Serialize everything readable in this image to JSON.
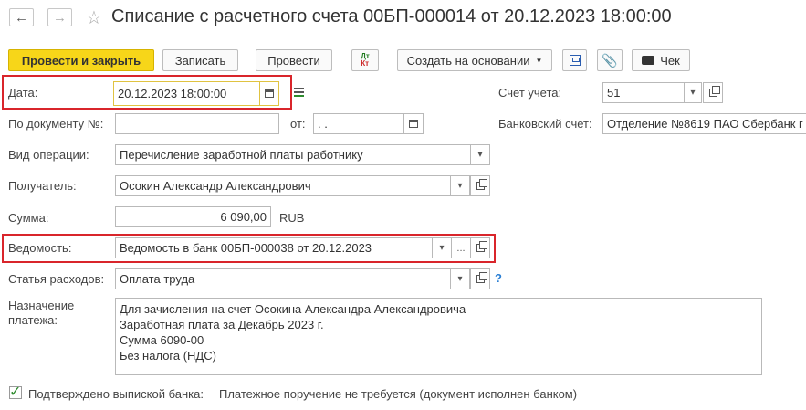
{
  "window": {
    "title": "Списание с расчетного счета 00БП-000014 от 20.12.2023 18:00:00",
    "back_icon": "←",
    "forward_icon": "→",
    "star_icon": "☆"
  },
  "toolbar": {
    "post_close": "Провести и закрыть",
    "save": "Записать",
    "post": "Провести",
    "dt_kt": "Дт Кт",
    "create_based": "Создать на основании",
    "receipt": "Чек"
  },
  "form": {
    "date_label": "Дата:",
    "date_value": "20.12.2023 18:00:00",
    "doc_no_label": "По документу №:",
    "doc_no_value": "",
    "from_label": "от:",
    "from_value": " .  .",
    "operation_label": "Вид операции:",
    "operation_value": "Перечисление заработной платы работнику",
    "recipient_label": "Получатель:",
    "recipient_value": "Осокин Александр Александрович",
    "sum_label": "Сумма:",
    "sum_value": "6 090,00",
    "currency": "RUB",
    "statement_label": "Ведомость:",
    "statement_value": "Ведомость в банк 00БП-000038 от 20.12.2023",
    "expense_label": "Статья расходов:",
    "expense_value": "Оплата труда",
    "help": "?",
    "purpose_label_1": "Назначение",
    "purpose_label_2": "платежа:",
    "purpose_value": "Для зачисления на счет Осокина Александра Александровича\nЗаработная плата за Декабрь 2023 г.\nСумма 6090-00\nБез налога (НДС)",
    "account_label": "Счет учета:",
    "account_value": "51",
    "bank_account_label": "Банковский счет:",
    "bank_account_value": "Отделение №8619 ПАО Сбербанк г",
    "confirmed_label": "Подтверждено выпиской банка:",
    "confirmed_checked": true,
    "payment_order_text": "Платежное поручение не требуется (документ исполнен банком)"
  },
  "colors": {
    "primary_button": "#f7d619",
    "highlight_border": "#d9252b",
    "active_field_border": "#e0c341",
    "checkbox_check": "#2e8b2e"
  }
}
